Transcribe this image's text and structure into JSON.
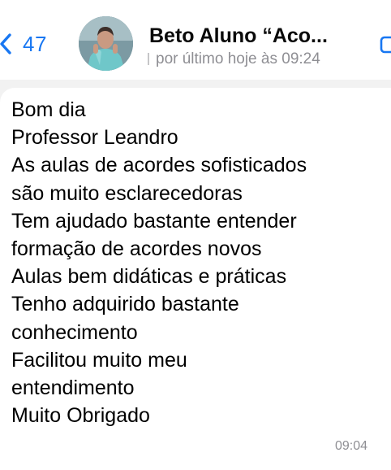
{
  "header": {
    "back_count": "47",
    "contact_name": "Beto Aluno “Aco...",
    "status": "por último hoje às 09:24"
  },
  "icons": {
    "back": "chevron-left-icon",
    "avatar": "contact-photo",
    "call": "video-call-icon"
  },
  "message": {
    "lines": [
      "Bom dia",
      "Professor Leandro",
      "As aulas de acordes sofisticados",
      "são muito esclarecedoras",
      "Tem ajudado bastante entender",
      "formação de acordes novos",
      "Aulas bem didáticas e práticas",
      "Tenho adquirido bastante",
      "conhecimento",
      "Facilitou muito meu",
      "entendimento",
      "Muito Obrigado"
    ],
    "time": "09:04"
  },
  "colors": {
    "accent": "#1877f2",
    "background": "#f2f2f2",
    "bubble": "#ffffff",
    "secondary_text": "#8e8e93"
  }
}
